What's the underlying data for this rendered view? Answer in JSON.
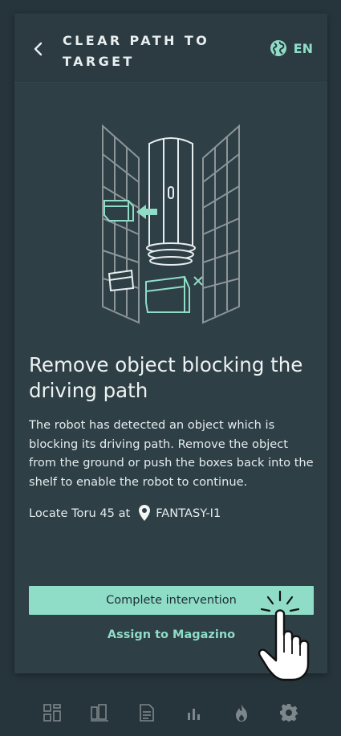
{
  "header": {
    "title": "CLEAR PATH TO TARGET",
    "language": "EN",
    "back_icon": "chevron-left-icon",
    "globe_icon": "globe-icon"
  },
  "main": {
    "heading": "Remove object blocking the driving path",
    "description": "The robot has detected an object which is blocking its driving path. Remove the object from the ground or push the boxes back into the shelf to enable the robot to continue.",
    "locate_text": "Locate Toru 45 at",
    "location": "FANTASY-I1"
  },
  "actions": {
    "primary_label": "Complete intervention",
    "secondary_label": "Assign to Magazino"
  },
  "nav": {
    "items": [
      {
        "icon": "dashboard-icon"
      },
      {
        "icon": "shelves-icon"
      },
      {
        "icon": "document-icon"
      },
      {
        "icon": "bar-chart-icon"
      },
      {
        "icon": "flame-icon"
      },
      {
        "icon": "settings-icon"
      }
    ]
  },
  "colors": {
    "accent": "#8fdcc7",
    "card_bg": "#2e3f45",
    "page_bg": "#26353b",
    "text": "#eef2f3"
  }
}
